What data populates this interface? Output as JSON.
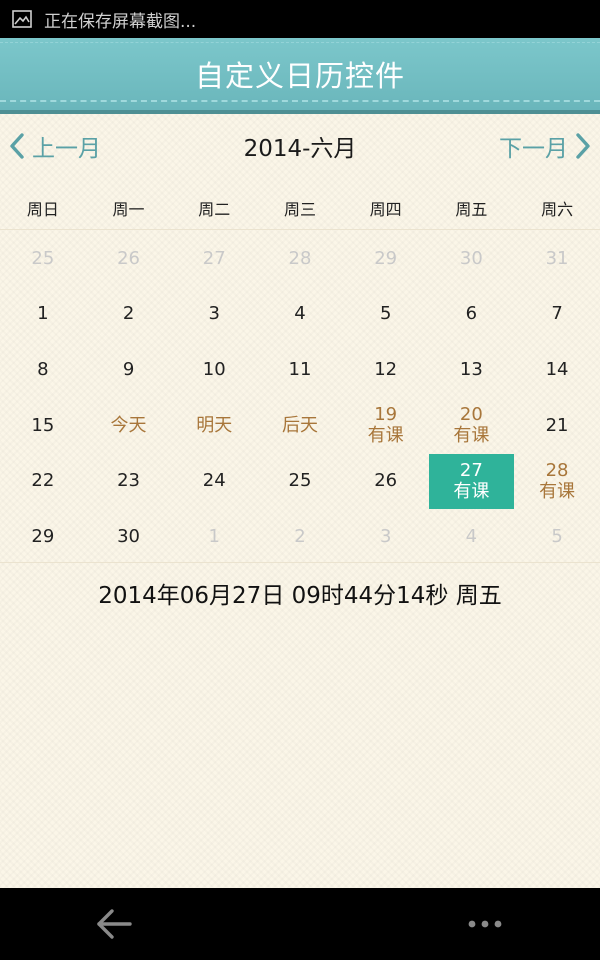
{
  "status_bar": {
    "text": "正在保存屏幕截图...",
    "icon": "image-icon"
  },
  "header": {
    "title": "自定义日历控件"
  },
  "month_nav": {
    "prev_label": "上一月",
    "next_label": "下一月",
    "title": "2014-六月"
  },
  "weekdays": [
    "周日",
    "周一",
    "周二",
    "周三",
    "周四",
    "周五",
    "周六"
  ],
  "weeks": [
    [
      {
        "num": "25",
        "note": "",
        "type": "other"
      },
      {
        "num": "26",
        "note": "",
        "type": "other"
      },
      {
        "num": "27",
        "note": "",
        "type": "other"
      },
      {
        "num": "28",
        "note": "",
        "type": "other"
      },
      {
        "num": "29",
        "note": "",
        "type": "other"
      },
      {
        "num": "30",
        "note": "",
        "type": "other"
      },
      {
        "num": "31",
        "note": "",
        "type": "other"
      }
    ],
    [
      {
        "num": "1",
        "note": "",
        "type": "normal"
      },
      {
        "num": "2",
        "note": "",
        "type": "normal"
      },
      {
        "num": "3",
        "note": "",
        "type": "normal"
      },
      {
        "num": "4",
        "note": "",
        "type": "normal"
      },
      {
        "num": "5",
        "note": "",
        "type": "normal"
      },
      {
        "num": "6",
        "note": "",
        "type": "normal"
      },
      {
        "num": "7",
        "note": "",
        "type": "normal"
      }
    ],
    [
      {
        "num": "8",
        "note": "",
        "type": "normal"
      },
      {
        "num": "9",
        "note": "",
        "type": "normal"
      },
      {
        "num": "10",
        "note": "",
        "type": "normal"
      },
      {
        "num": "11",
        "note": "",
        "type": "normal"
      },
      {
        "num": "12",
        "note": "",
        "type": "normal"
      },
      {
        "num": "13",
        "note": "",
        "type": "normal"
      },
      {
        "num": "14",
        "note": "",
        "type": "normal"
      }
    ],
    [
      {
        "num": "15",
        "note": "",
        "type": "normal"
      },
      {
        "num": "今天",
        "note": "",
        "type": "special"
      },
      {
        "num": "明天",
        "note": "",
        "type": "special"
      },
      {
        "num": "后天",
        "note": "",
        "type": "special"
      },
      {
        "num": "19",
        "note": "有课",
        "type": "special"
      },
      {
        "num": "20",
        "note": "有课",
        "type": "special"
      },
      {
        "num": "21",
        "note": "",
        "type": "normal"
      }
    ],
    [
      {
        "num": "22",
        "note": "",
        "type": "normal"
      },
      {
        "num": "23",
        "note": "",
        "type": "normal"
      },
      {
        "num": "24",
        "note": "",
        "type": "normal"
      },
      {
        "num": "25",
        "note": "",
        "type": "normal"
      },
      {
        "num": "26",
        "note": "",
        "type": "normal"
      },
      {
        "num": "27",
        "note": "有课",
        "type": "selected"
      },
      {
        "num": "28",
        "note": "有课",
        "type": "special"
      }
    ],
    [
      {
        "num": "29",
        "note": "",
        "type": "normal"
      },
      {
        "num": "30",
        "note": "",
        "type": "normal"
      },
      {
        "num": "1",
        "note": "",
        "type": "other"
      },
      {
        "num": "2",
        "note": "",
        "type": "other"
      },
      {
        "num": "3",
        "note": "",
        "type": "other"
      },
      {
        "num": "4",
        "note": "",
        "type": "other"
      },
      {
        "num": "5",
        "note": "",
        "type": "other"
      }
    ]
  ],
  "datetime": "2014年06月27日 09时44分14秒 周五",
  "bottom_bar": {
    "back_icon": "back-arrow-icon",
    "more_icon": "more-dots-icon"
  },
  "colors": {
    "header": "#6ab6bb",
    "accent": "#5aa1a6",
    "selected": "#2fb39a",
    "special": "#a8763a",
    "other_month": "#c9c9c9"
  }
}
